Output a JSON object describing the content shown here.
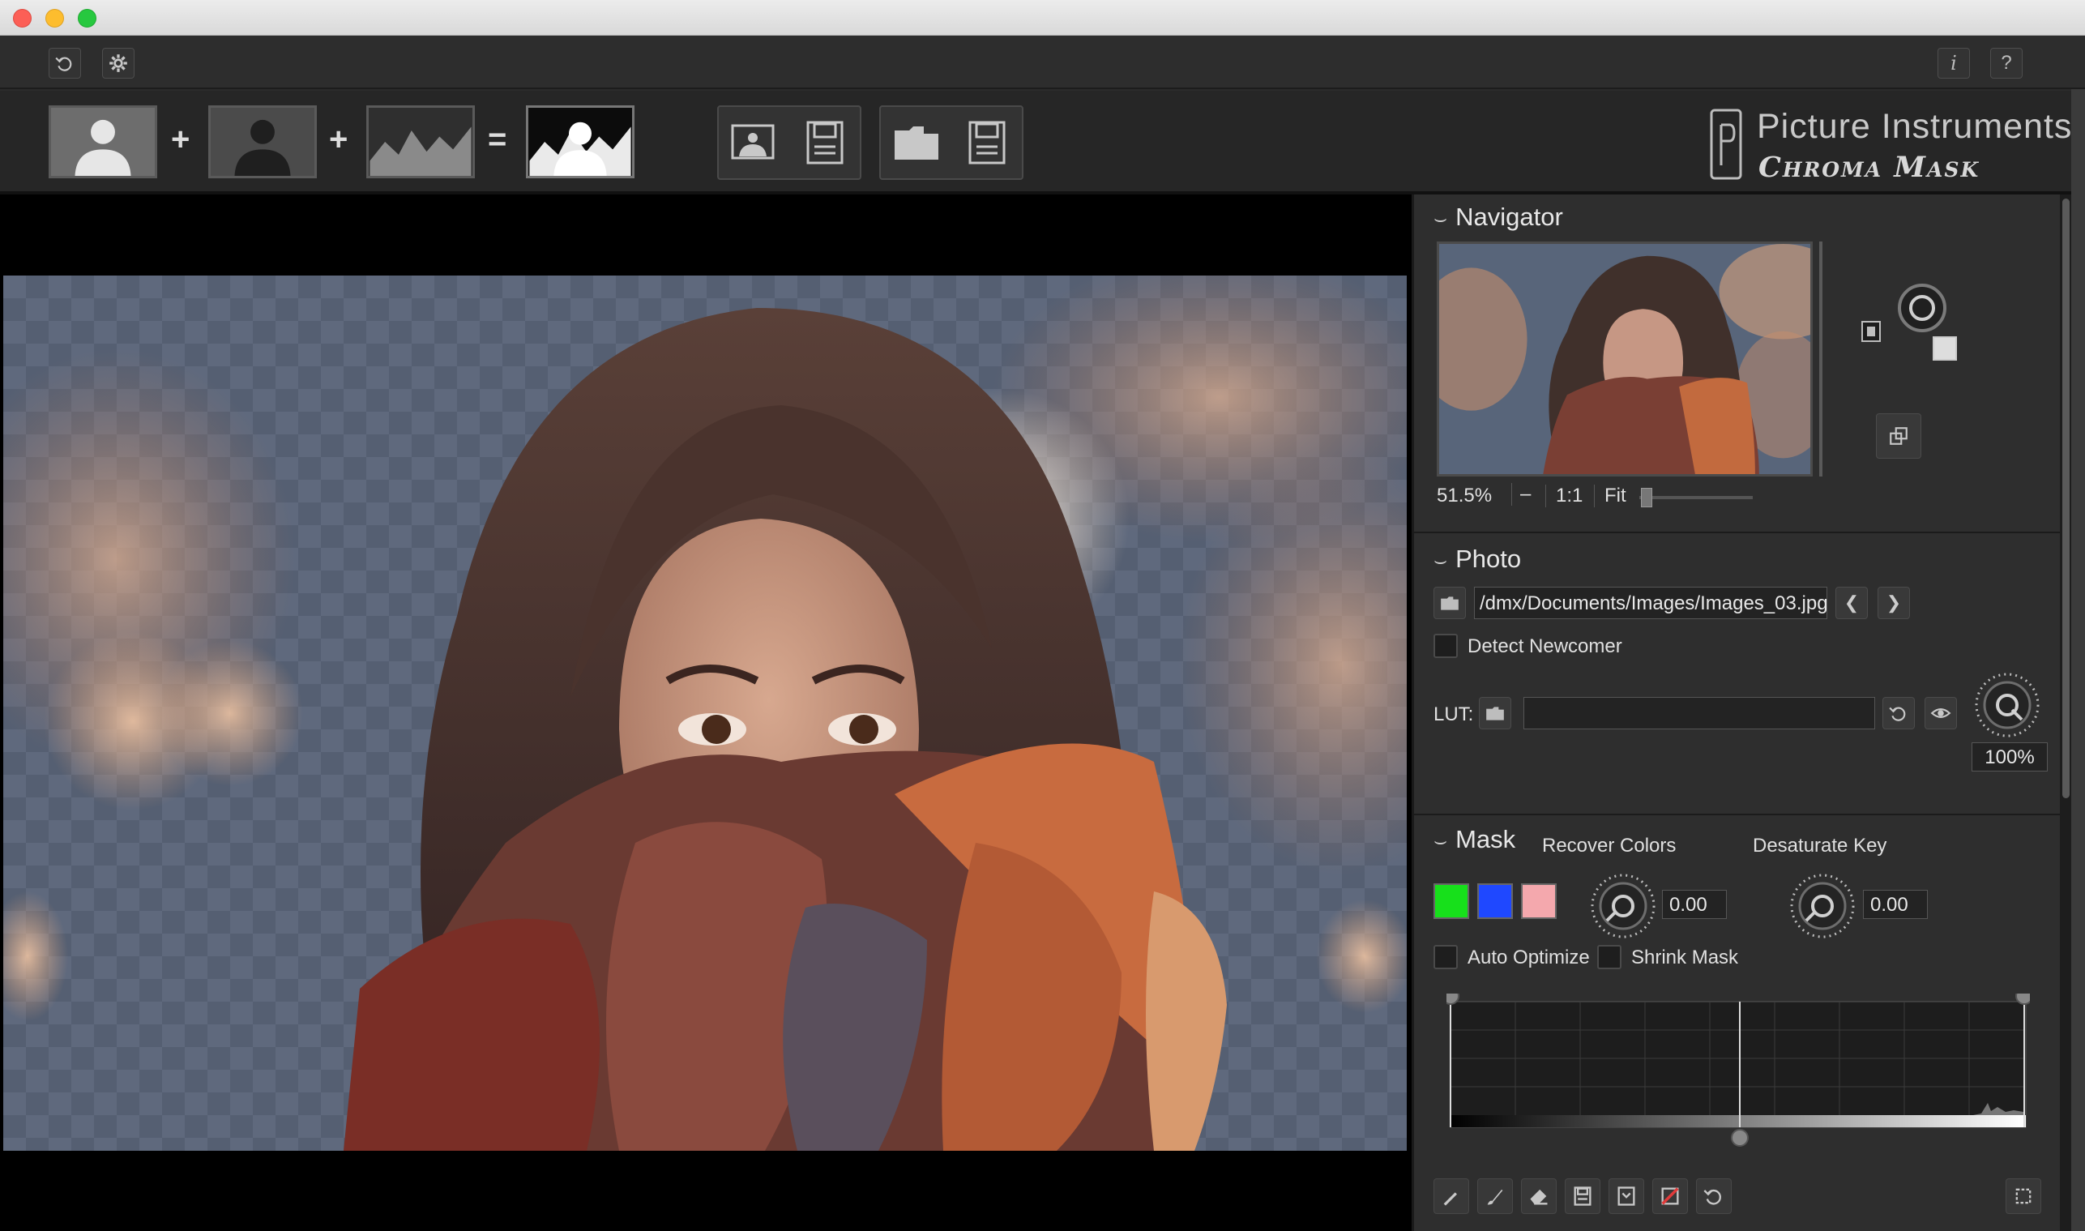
{
  "toolbar_top": {
    "reset_icon": "rotate-ccw-icon",
    "settings_icon": "gear-icon",
    "info_label": "i",
    "help_label": "?"
  },
  "pipeline": {
    "plus1": "+",
    "plus2": "+",
    "equals": "="
  },
  "brand": {
    "title": "Picture Instruments",
    "subtitle": "Chroma Mask"
  },
  "navigator": {
    "header": "Navigator",
    "zoom_value": "51.5%",
    "zoom_dash": "–",
    "one_to_one": "1:1",
    "fit": "Fit"
  },
  "photo": {
    "header": "Photo",
    "path": "/dmx/Documents/Images/Images_03.jpg",
    "prev": "❮",
    "next": "❯",
    "detect_newcomer": "Detect Newcomer",
    "lut_label": "LUT:",
    "lut_value": "",
    "lut_opacity": "100%"
  },
  "mask": {
    "header": "Mask",
    "recover_colors_label": "Recover Colors",
    "recover_colors_value": "0.00",
    "desaturate_key_label": "Desaturate Key",
    "desaturate_key_value": "0.00",
    "swatches": [
      "#17e01b",
      "#1f48ff",
      "#f4a8ad"
    ],
    "auto_optimize": "Auto Optimize",
    "shrink_mask": "Shrink Mask"
  }
}
